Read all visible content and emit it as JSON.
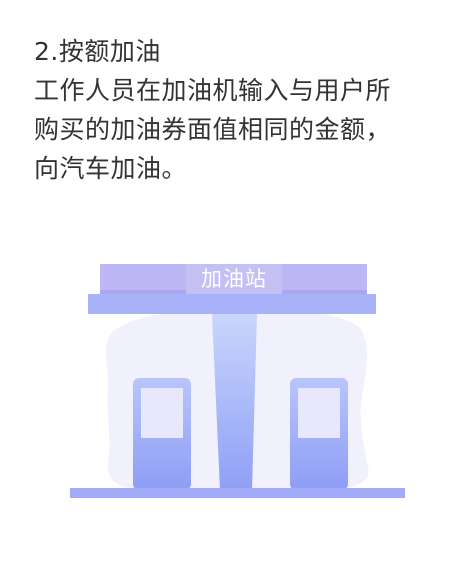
{
  "heading": "2.按额加油",
  "description_lines": [
    "工作人员在加油机输入与用户所",
    "购买的加油券面值相同的金额，",
    "向汽车加油。"
  ],
  "illustration": {
    "sign_text": "加油站",
    "colors": {
      "canopy_top": "#bdb8f5",
      "canopy_band": "#aaa6ee",
      "canopy_base": "#a9b2f8",
      "blob": "#f1f1fd",
      "pillar_top": "#c9d6fb",
      "pillar_bottom": "#8f9ff6",
      "pump_top": "#b9c5fa",
      "pump_bottom": "#8e9df6",
      "pump_screen": "#e7e8fc",
      "ground": "#a0aaf7"
    }
  }
}
